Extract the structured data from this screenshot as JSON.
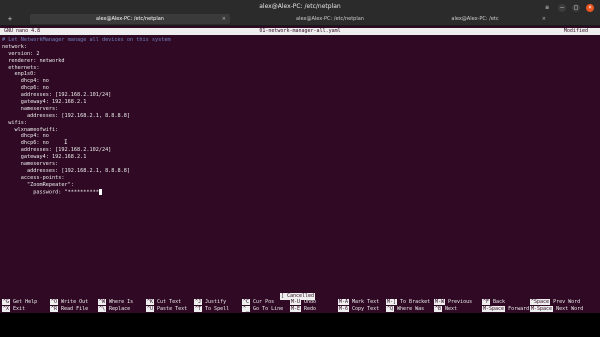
{
  "window": {
    "title": "alex@Alex-PC: /etc/netplan",
    "tabs": [
      {
        "label": "alex@Alex-PC: /etc/netplan",
        "active": true
      },
      {
        "label": "alex@Alex-PC: /etc/netplan",
        "active": false
      },
      {
        "label": "alex@Alex-PC: /etc",
        "active": false
      }
    ],
    "tab_close": "×",
    "new_tab": "+",
    "menu_icon": "≡",
    "min_icon": "–",
    "max_icon": "□",
    "close_icon": "×"
  },
  "nano": {
    "version": "GNU nano 4.8",
    "filename": "01-network-manager-all.yaml",
    "state": "Modified",
    "lines": [
      {
        "text": "# Let NetworkManager manage all devices on this system",
        "type": "comment"
      },
      {
        "text": "network:",
        "type": "code"
      },
      {
        "text": "  version: 2",
        "type": "code"
      },
      {
        "text": "  renderer: networkd",
        "type": "code"
      },
      {
        "text": "  ethernets:",
        "type": "code"
      },
      {
        "text": "    enp1s0:",
        "type": "code"
      },
      {
        "text": "      dhcp4: no",
        "type": "code"
      },
      {
        "text": "      dhcp6: no",
        "type": "code"
      },
      {
        "text": "      addresses: [192.168.2.101/24]",
        "type": "code"
      },
      {
        "text": "      gateway4: 192.168.2.1",
        "type": "code"
      },
      {
        "text": "      nameservers:",
        "type": "code"
      },
      {
        "text": "        addresses: [192.168.2.1, 8.8.8.8]",
        "type": "code"
      },
      {
        "text": "  wifis:",
        "type": "code"
      },
      {
        "text": "    wlxnameofwifi:",
        "type": "code"
      },
      {
        "text": "      dhcp4: no",
        "type": "code"
      },
      {
        "text": "      dhcp6: no",
        "type": "code"
      },
      {
        "text": "      addresses: [192.168.2.102/24]",
        "type": "code"
      },
      {
        "text": "      gateway4: 192.168.2.1",
        "type": "code"
      },
      {
        "text": "      nameservers:",
        "type": "code"
      },
      {
        "text": "        addresses: [192.168.2.1, 8.8.8.8]",
        "type": "code"
      },
      {
        "text": "      access-points:",
        "type": "code"
      },
      {
        "text": "        \"ZoomRepeater\":",
        "type": "code"
      },
      {
        "text": "          password: \"**********",
        "type": "code",
        "cursor": true
      }
    ],
    "status_message": "[ Cancelled ]",
    "shortcuts": [
      {
        "key": "^G",
        "label": "Get Help"
      },
      {
        "key": "^X",
        "label": "Exit"
      },
      {
        "key": "^O",
        "label": "Write Out"
      },
      {
        "key": "^R",
        "label": "Read File"
      },
      {
        "key": "^W",
        "label": "Where Is"
      },
      {
        "key": "^\\",
        "label": "Replace"
      },
      {
        "key": "^K",
        "label": "Cut Text"
      },
      {
        "key": "^U",
        "label": "Paste Text"
      },
      {
        "key": "^J",
        "label": "Justify"
      },
      {
        "key": "^T",
        "label": "To Spell"
      },
      {
        "key": "^C",
        "label": "Cur Pos"
      },
      {
        "key": "^_",
        "label": "Go To Line"
      },
      {
        "key": "M-U",
        "label": "Undo"
      },
      {
        "key": "M-E",
        "label": "Redo"
      },
      {
        "key": "M-A",
        "label": "Mark Text"
      },
      {
        "key": "M-6",
        "label": "Copy Text"
      },
      {
        "key": "M-]",
        "label": "To Bracket"
      },
      {
        "key": "^Q",
        "label": "Where Was"
      },
      {
        "key": "M-W",
        "label": "Previous"
      },
      {
        "key": "^B",
        "label": "Next"
      },
      {
        "key": "^F",
        "label": "Back"
      },
      {
        "key": "M-Space",
        "label": "Forward"
      },
      {
        "key": "^Space",
        "label": "Prev Word"
      },
      {
        "key": "M-Space",
        "label": "Next Word"
      }
    ]
  },
  "colors": {
    "terminal_bg": "#300a24",
    "bar_fg": "#eeeeee",
    "close_accent": "#e95420"
  }
}
